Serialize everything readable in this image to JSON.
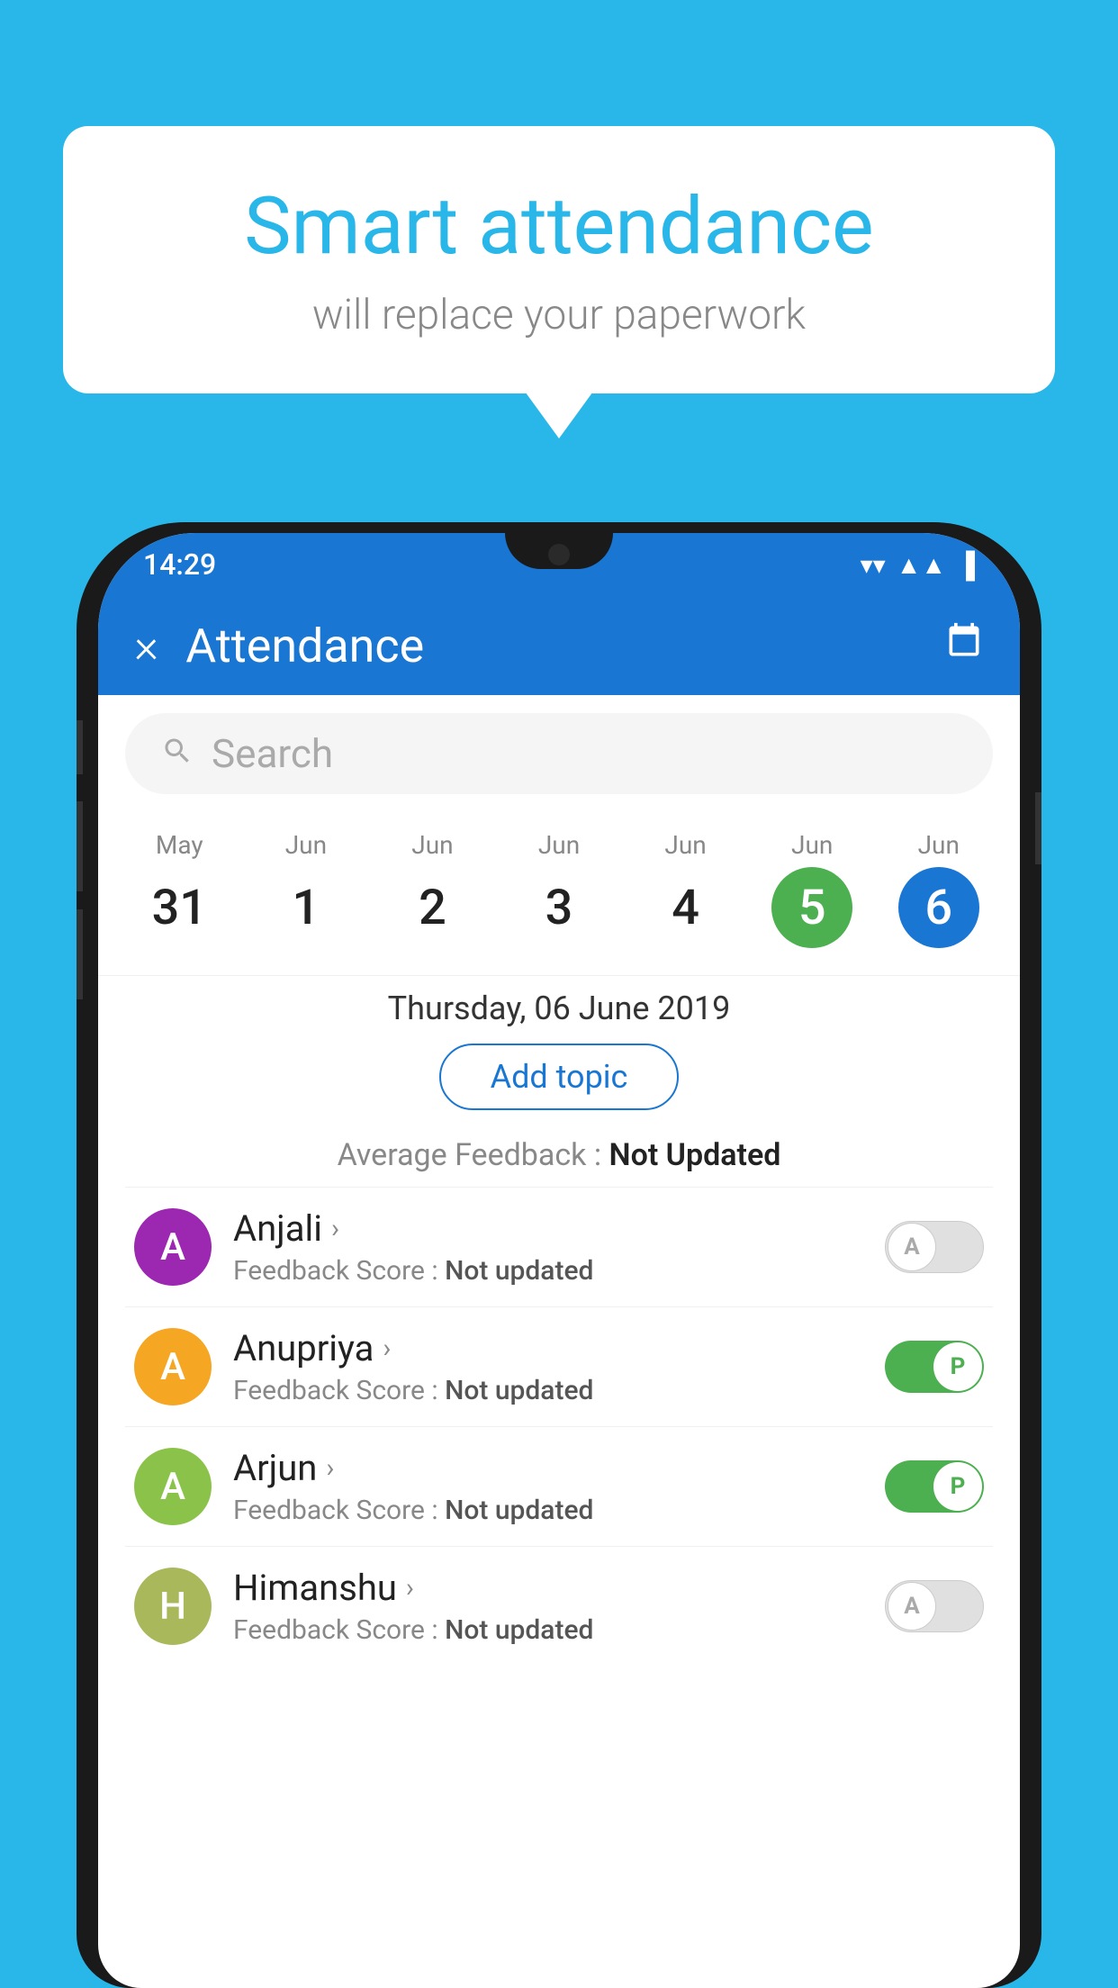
{
  "app": {
    "background_color": "#29b6e8"
  },
  "speech_bubble": {
    "headline": "Smart attendance",
    "subtext": "will replace your paperwork"
  },
  "status_bar": {
    "time": "14:29",
    "icons": [
      "wifi",
      "signal",
      "battery"
    ]
  },
  "app_bar": {
    "title": "Attendance",
    "close_icon": "×",
    "calendar_icon": "📅"
  },
  "search": {
    "placeholder": "Search"
  },
  "calendar": {
    "dates": [
      {
        "month": "May",
        "day": "31",
        "style": "normal"
      },
      {
        "month": "Jun",
        "day": "1",
        "style": "normal"
      },
      {
        "month": "Jun",
        "day": "2",
        "style": "normal"
      },
      {
        "month": "Jun",
        "day": "3",
        "style": "normal"
      },
      {
        "month": "Jun",
        "day": "4",
        "style": "normal"
      },
      {
        "month": "Jun",
        "day": "5",
        "style": "today"
      },
      {
        "month": "Jun",
        "day": "6",
        "style": "selected"
      }
    ],
    "selected_date_label": "Thursday, 06 June 2019"
  },
  "add_topic_button": "Add topic",
  "avg_feedback": {
    "label": "Average Feedback : ",
    "value": "Not Updated"
  },
  "students": [
    {
      "name": "Anjali",
      "initial": "A",
      "avatar_color": "#9c27b0",
      "feedback_label": "Feedback Score : ",
      "feedback_value": "Not updated",
      "toggle": "off",
      "toggle_letter": "A"
    },
    {
      "name": "Anupriya",
      "initial": "A",
      "avatar_color": "#f5a623",
      "feedback_label": "Feedback Score : ",
      "feedback_value": "Not updated",
      "toggle": "on",
      "toggle_letter": "P"
    },
    {
      "name": "Arjun",
      "initial": "A",
      "avatar_color": "#8bc34a",
      "feedback_label": "Feedback Score : ",
      "feedback_value": "Not updated",
      "toggle": "on",
      "toggle_letter": "P"
    },
    {
      "name": "Himanshu",
      "initial": "H",
      "avatar_color": "#aab85c",
      "feedback_label": "Feedback Score : ",
      "feedback_value": "Not updated",
      "toggle": "off",
      "toggle_letter": "A"
    }
  ]
}
